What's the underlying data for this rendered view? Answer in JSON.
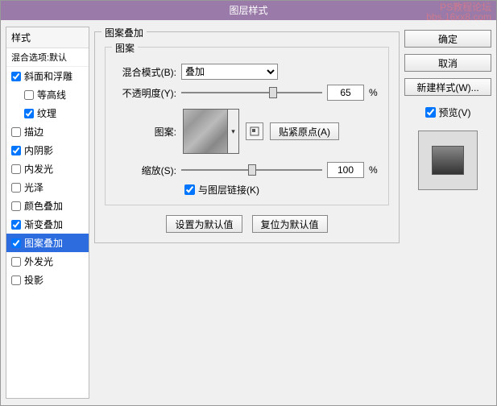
{
  "title": "图层样式",
  "watermark": {
    "line1": "PS教程论坛",
    "line2": "bbs.16xx8.com"
  },
  "stylesPanel": {
    "header": "样式",
    "sub": "混合选项:默认",
    "items": [
      {
        "label": "斜面和浮雕",
        "checked": true,
        "indent": false,
        "selected": false
      },
      {
        "label": "等高线",
        "checked": false,
        "indent": true,
        "selected": false
      },
      {
        "label": "纹理",
        "checked": true,
        "indent": true,
        "selected": false
      },
      {
        "label": "描边",
        "checked": false,
        "indent": false,
        "selected": false
      },
      {
        "label": "内阴影",
        "checked": true,
        "indent": false,
        "selected": false
      },
      {
        "label": "内发光",
        "checked": false,
        "indent": false,
        "selected": false
      },
      {
        "label": "光泽",
        "checked": false,
        "indent": false,
        "selected": false
      },
      {
        "label": "颜色叠加",
        "checked": false,
        "indent": false,
        "selected": false
      },
      {
        "label": "渐变叠加",
        "checked": true,
        "indent": false,
        "selected": false
      },
      {
        "label": "图案叠加",
        "checked": true,
        "indent": false,
        "selected": true
      },
      {
        "label": "外发光",
        "checked": false,
        "indent": false,
        "selected": false
      },
      {
        "label": "投影",
        "checked": false,
        "indent": false,
        "selected": false
      }
    ]
  },
  "settings": {
    "groupTitle": "图案叠加",
    "innerTitle": "图案",
    "blendMode": {
      "label": "混合模式(B):",
      "value": "叠加"
    },
    "opacity": {
      "label": "不透明度(Y):",
      "value": "65",
      "pct": "%",
      "thumbPct": 65
    },
    "pattern": {
      "label": "图案:",
      "snapBtn": "贴紧原点(A)"
    },
    "scale": {
      "label": "缩放(S):",
      "value": "100",
      "pct": "%",
      "thumbPct": 50
    },
    "linkLayer": {
      "label": "与图层链接(K)",
      "checked": true
    },
    "defaultsBtn": "设置为默认值",
    "resetBtn": "复位为默认值"
  },
  "right": {
    "ok": "确定",
    "cancel": "取消",
    "newStyle": "新建样式(W)...",
    "preview": "预览(V)",
    "previewChecked": true
  }
}
